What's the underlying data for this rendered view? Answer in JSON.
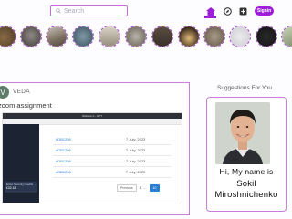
{
  "search": {
    "placeholder": "Search"
  },
  "nav": {
    "signin_label": "Signin",
    "accent": "#9d1ed7"
  },
  "stories": {
    "count": 12
  },
  "post": {
    "avatar_initial": "V",
    "author": "VEDA",
    "title": "zoom assignment",
    "screenshot": {
      "window_title": "Website A - GPT",
      "rows": [
        {
          "id": "#DB1208",
          "date": "7 July, 2023"
        },
        {
          "id": "#DB1208",
          "date": "7 July, 2023"
        },
        {
          "id": "#DB1208",
          "date": "7 July, 2023"
        },
        {
          "id": "#DB1208",
          "date": "7 July, 2023"
        }
      ],
      "pager": {
        "prev_label": "Previous",
        "page": "1",
        "dots": "...",
        "current": "10"
      },
      "prompt": {
        "label": "Enter Security Credits",
        "value": "£32.18"
      }
    }
  },
  "suggestions": {
    "title": "Suggestions For You",
    "greeting": "Hi, My name is",
    "first_name": "Sokil",
    "last_name": "Miroshnichenko"
  }
}
